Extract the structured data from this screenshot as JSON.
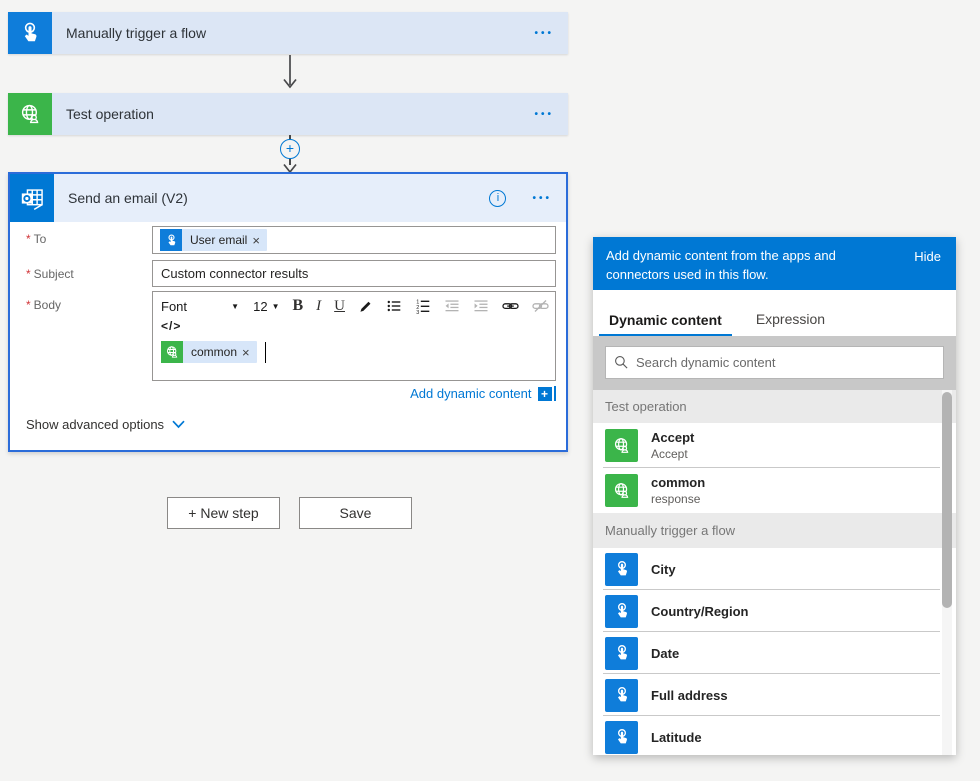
{
  "icons": {
    "ellipsis": "•••",
    "close": "×",
    "caret_down": "▼",
    "plus": "+",
    "info": "i",
    "code_view": "</>"
  },
  "flow": {
    "trigger_card": {
      "title": "Manually trigger a flow"
    },
    "test_card": {
      "title": "Test operation"
    },
    "email_card": {
      "title": "Send an email (V2)",
      "required_mark": "*",
      "to_label": "To",
      "to_pill": "User email",
      "subject_label": "Subject",
      "subject_value": "Custom connector results",
      "body_label": "Body",
      "body_pill": "common",
      "toolbar": {
        "font": "Font",
        "size": "12",
        "bold": "B",
        "italic": "I",
        "underline": "U"
      },
      "add_dynamic_content": "Add dynamic content",
      "show_advanced_options": "Show advanced options"
    },
    "new_step_button": "+ New step",
    "save_button": "Save"
  },
  "panel": {
    "header_text": "Add dynamic content from the apps and connectors used in this flow.",
    "hide_button": "Hide",
    "tabs": {
      "dynamic_content": "Dynamic content",
      "expression": "Expression"
    },
    "search_placeholder": "Search dynamic content",
    "sections": [
      {
        "header": "Test operation",
        "items": [
          {
            "title": "Accept",
            "subtitle": "Accept"
          },
          {
            "title": "common",
            "subtitle": "response"
          }
        ]
      },
      {
        "header": "Manually trigger a flow",
        "items": [
          {
            "title": "City"
          },
          {
            "title": "Country/Region"
          },
          {
            "title": "Date"
          },
          {
            "title": "Full address"
          },
          {
            "title": "Latitude"
          }
        ]
      }
    ]
  },
  "colors": {
    "accent": "#0078d4",
    "trigger_blue": "#0f7dda",
    "connector_green": "#3bb54a",
    "card_bg": "#dce6f5",
    "selected_border": "#2b6cd9"
  }
}
